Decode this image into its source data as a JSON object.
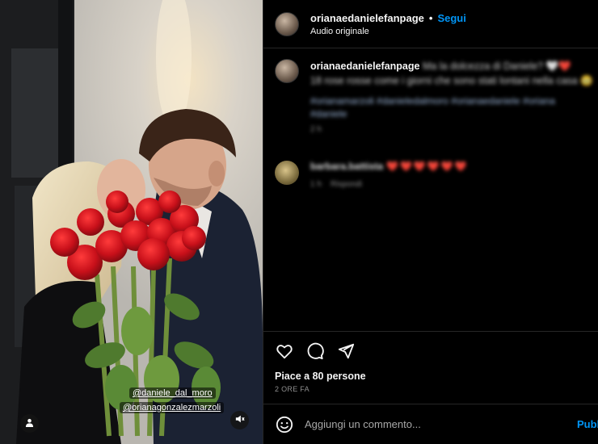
{
  "post": {
    "username": "orianaedanielefanpage",
    "separator": "•",
    "follow_label": "Segui",
    "audio_label": "Audio originale"
  },
  "media": {
    "mention_1": "@daniele_dal_moro",
    "mention_2": "@orianagonzalezmarzoli"
  },
  "caption": {
    "username": "orianaedanielefanpage",
    "text_line_1": "Ma la dolcezza di Daniele? 🤍❤️",
    "text_line_2": "18 rose rosse come i giorni che sono stati lontani nella casa 🥹",
    "hashtags": "#orianamarzoli #danieledalmoro #orianaedaniele #oriana #daniele",
    "time": "2 h"
  },
  "comment": {
    "username": "barbara.battista",
    "hearts": "❤️❤️❤️❤️❤️❤️",
    "time": "1 h",
    "reply_label": "Rispondi"
  },
  "actions": {
    "likes_text": "Piace a 80 persone",
    "time_ago": "2 ORE FA"
  },
  "composer": {
    "placeholder": "Aggiungi un commento...",
    "publish_label": "Pubblica"
  },
  "icons": {
    "like": "heart-icon",
    "comment": "comment-icon",
    "share": "share-icon",
    "emoji": "emoji-icon",
    "tag": "person-tag-icon",
    "mute": "muted-speaker-icon"
  },
  "colors": {
    "accent": "#0095f6",
    "background": "#000000",
    "divider": "#262626",
    "roses": "#d0121f"
  }
}
